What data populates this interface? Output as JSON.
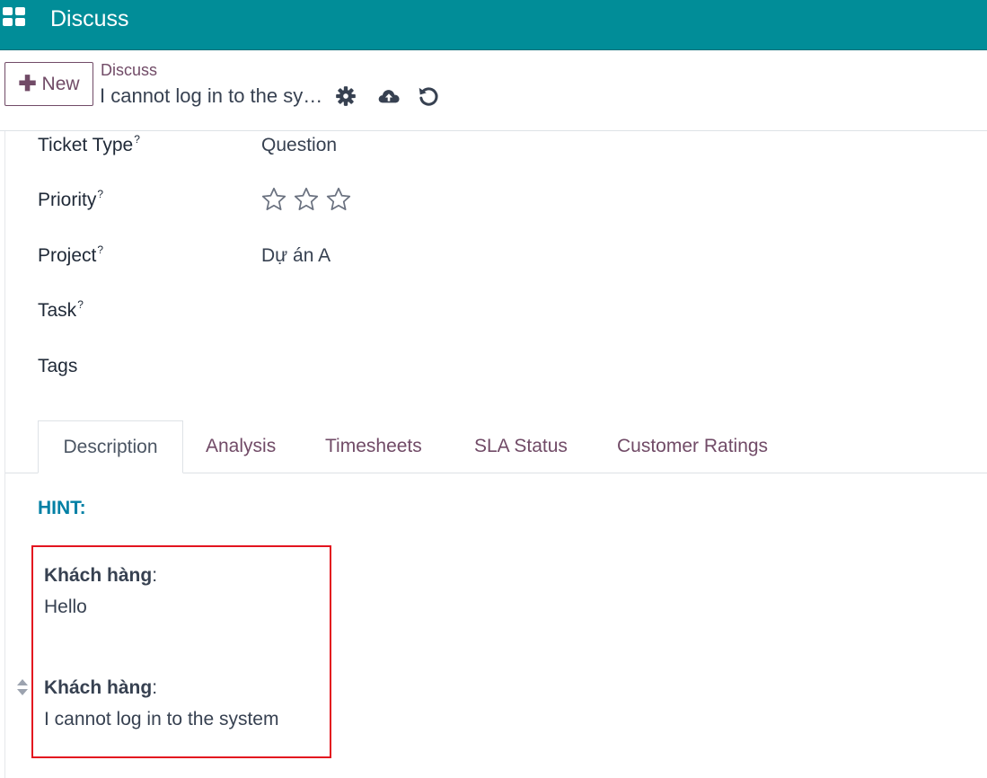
{
  "header": {
    "app_title": "Discuss",
    "apps_icon": "grid-apps-icon",
    "bg_color": "#018d98"
  },
  "control": {
    "new_label": "New",
    "breadcrumb": "Discuss",
    "record_name": "I cannot log in to the system",
    "icons": [
      "gear-icon",
      "cloud-upload-icon",
      "discard-icon"
    ],
    "accent_color": "#714b67"
  },
  "fields": {
    "ticket_type": {
      "label": "Ticket Type",
      "help": "?",
      "value": "Question"
    },
    "priority": {
      "label": "Priority",
      "help": "?",
      "stars_filled": 0,
      "stars_total": 3
    },
    "project": {
      "label": "Project",
      "help": "?",
      "value": "Dự án A"
    },
    "task": {
      "label": "Task",
      "help": "?",
      "value": ""
    },
    "tags": {
      "label": "Tags",
      "value": ""
    }
  },
  "tabs": [
    {
      "label": "Description",
      "active": true
    },
    {
      "label": "Analysis"
    },
    {
      "label": "Timesheets"
    },
    {
      "label": "SLA Status"
    },
    {
      "label": "Customer Ratings"
    }
  ],
  "description": {
    "hint": "HINT:",
    "messages": [
      {
        "author": "Khách hàng",
        "text": "Hello"
      },
      {
        "author": "Khách hàng",
        "text": "I cannot log in to the system"
      }
    ],
    "highlight_color": "#e3141f"
  }
}
